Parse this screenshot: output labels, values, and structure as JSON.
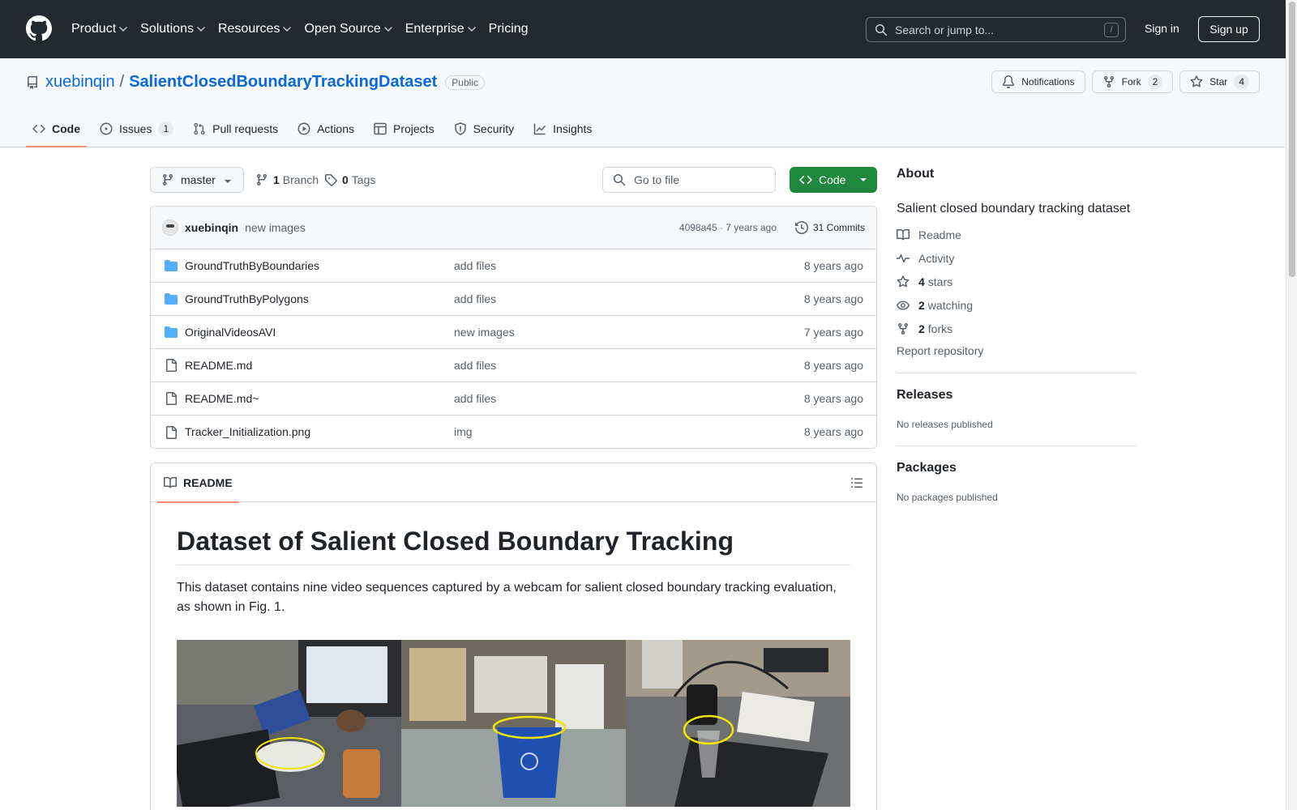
{
  "header": {
    "nav": [
      {
        "label": "Product",
        "dropdown": true
      },
      {
        "label": "Solutions",
        "dropdown": true
      },
      {
        "label": "Resources",
        "dropdown": true
      },
      {
        "label": "Open Source",
        "dropdown": true
      },
      {
        "label": "Enterprise",
        "dropdown": true
      },
      {
        "label": "Pricing",
        "dropdown": false
      }
    ],
    "search_placeholder": "Search or jump to...",
    "search_shortcut": "/",
    "signin": "Sign in",
    "signup": "Sign up"
  },
  "repo": {
    "owner": "xuebinqin",
    "separator": "/",
    "name": "SalientClosedBoundaryTrackingDataset",
    "visibility": "Public",
    "notifications": "Notifications",
    "fork_label": "Fork",
    "fork_count": "2",
    "star_label": "Star",
    "star_count": "4"
  },
  "tabs": [
    {
      "label": "Code",
      "active": true,
      "count": ""
    },
    {
      "label": "Issues",
      "active": false,
      "count": "1"
    },
    {
      "label": "Pull requests",
      "active": false,
      "count": ""
    },
    {
      "label": "Actions",
      "active": false,
      "count": ""
    },
    {
      "label": "Projects",
      "active": false,
      "count": ""
    },
    {
      "label": "Security",
      "active": false,
      "count": ""
    },
    {
      "label": "Insights",
      "active": false,
      "count": ""
    }
  ],
  "toolbar": {
    "branch": "master",
    "branch_count": "1",
    "branch_label": "Branch",
    "tag_count": "0",
    "tag_label": "Tags",
    "goto_placeholder": "Go to file",
    "code_button": "Code"
  },
  "commit": {
    "author": "xuebinqin",
    "message": "new images",
    "meta": "4098a45 · 7 years ago",
    "commits": "31 Commits"
  },
  "files": [
    {
      "type": "folder",
      "name": "GroundTruthByBoundaries",
      "message": "add files",
      "age": "8 years ago"
    },
    {
      "type": "folder",
      "name": "GroundTruthByPolygons",
      "message": "add files",
      "age": "8 years ago"
    },
    {
      "type": "folder",
      "name": "OriginalVideosAVI",
      "message": "new images",
      "age": "7 years ago"
    },
    {
      "type": "file",
      "name": "README.md",
      "message": "add files",
      "age": "8 years ago"
    },
    {
      "type": "file",
      "name": "README.md~",
      "message": "add files",
      "age": "8 years ago"
    },
    {
      "type": "file",
      "name": "Tracker_Initialization.png",
      "message": "img",
      "age": "8 years ago"
    }
  ],
  "readme": {
    "tab": "README",
    "title": "Dataset of Salient Closed Boundary Tracking",
    "paragraph": "This dataset contains nine video sequences captured by a webcam for salient closed boundary tracking evaluation, as shown in Fig. 1."
  },
  "about": {
    "heading": "About",
    "description": "Salient closed boundary tracking dataset",
    "items": [
      {
        "icon": "book-icon",
        "count": "",
        "label": "Readme"
      },
      {
        "icon": "pulse-icon",
        "count": "",
        "label": "Activity"
      },
      {
        "icon": "star-icon",
        "count": "4",
        "label": "stars"
      },
      {
        "icon": "eye-icon",
        "count": "2",
        "label": "watching"
      },
      {
        "icon": "fork-icon",
        "count": "2",
        "label": "forks"
      }
    ],
    "report": "Report repository"
  },
  "releases": {
    "heading": "Releases",
    "empty": "No releases published"
  },
  "packages": {
    "heading": "Packages",
    "empty": "No packages published"
  },
  "colors": {
    "header_bg": "#24292f",
    "accent": "#0969da",
    "green": "#1f883d",
    "tab_underline": "#fd8c73",
    "folder": "#54aeff"
  }
}
